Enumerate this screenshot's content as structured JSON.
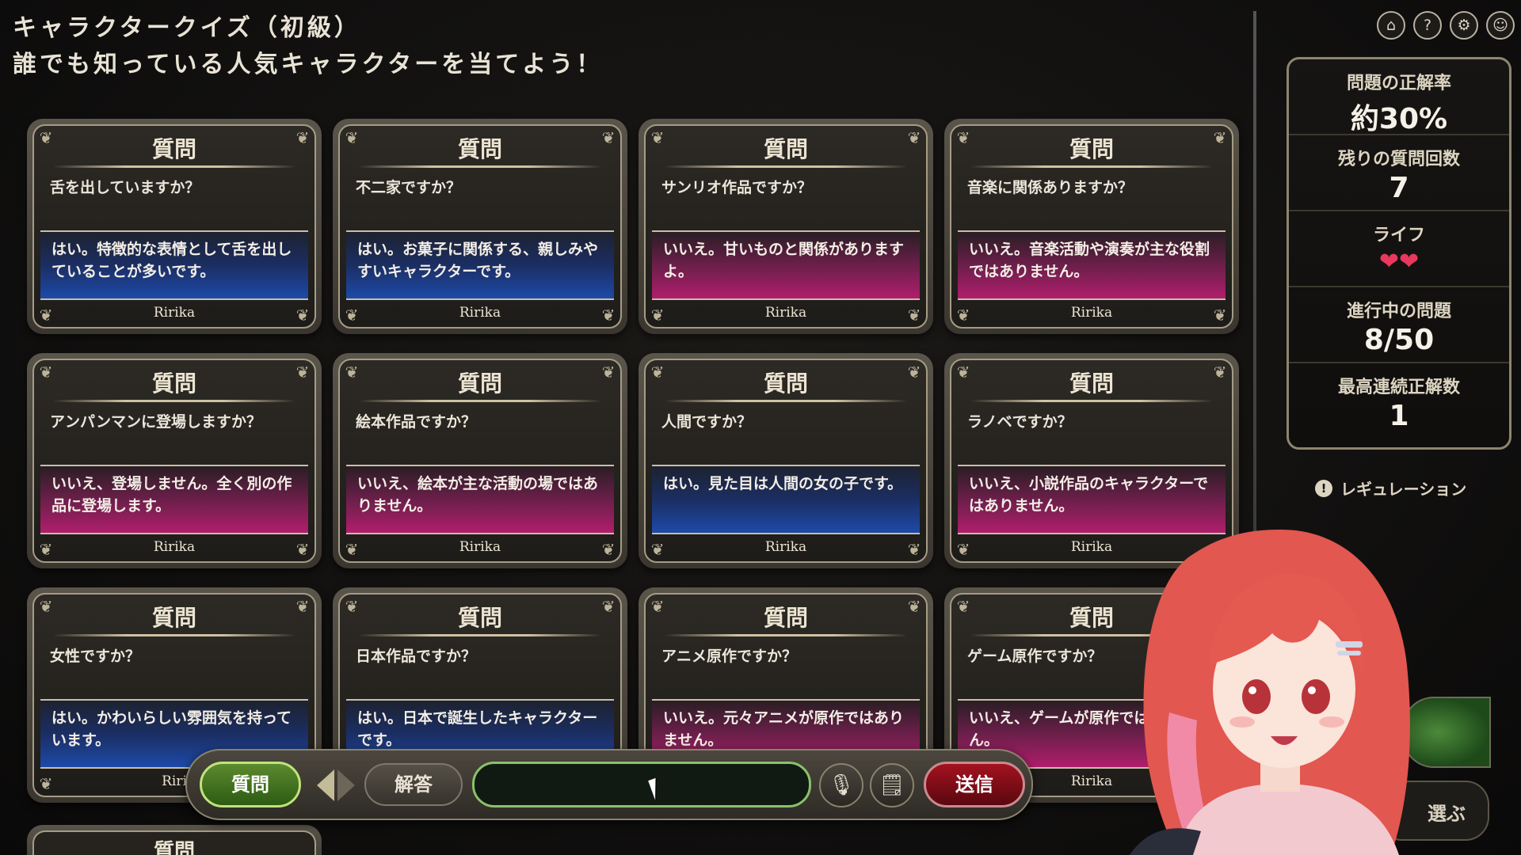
{
  "header": {
    "title": "キャラクタークイズ（初級）",
    "subtitle": "誰でも知っている人気キャラクターを当てよう！"
  },
  "cards": [
    {
      "head": "質問",
      "question": "舌を出していますか？",
      "answer": "はい。特徴的な表情として舌を出していることが多いです。",
      "result": "yes",
      "sig": "Ririka"
    },
    {
      "head": "質問",
      "question": "不二家ですか？",
      "answer": "はい。お菓子に関係する、親しみやすいキャラクターです。",
      "result": "yes",
      "sig": "Ririka"
    },
    {
      "head": "質問",
      "question": "サンリオ作品ですか？",
      "answer": "いいえ。甘いものと関係がありますよ。",
      "result": "no",
      "sig": "Ririka"
    },
    {
      "head": "質問",
      "question": "音楽に関係ありますか？",
      "answer": "いいえ。音楽活動や演奏が主な役割ではありません。",
      "result": "no",
      "sig": "Ririka"
    },
    {
      "head": "質問",
      "question": "アンパンマンに登場しますか？",
      "answer": "いいえ、登場しません。全く別の作品に登場します。",
      "result": "no",
      "sig": "Ririka"
    },
    {
      "head": "質問",
      "question": "絵本作品ですか？",
      "answer": "いいえ、絵本が主な活動の場ではありません。",
      "result": "no",
      "sig": "Ririka"
    },
    {
      "head": "質問",
      "question": "人間ですか？",
      "answer": "はい。見た目は人間の女の子です。",
      "result": "yes",
      "sig": "Ririka"
    },
    {
      "head": "質問",
      "question": "ラノベですか？",
      "answer": "いいえ、小説作品のキャラクターではありません。",
      "result": "no",
      "sig": "Ririka"
    },
    {
      "head": "質問",
      "question": "女性ですか？",
      "answer": "はい。かわいらしい雰囲気を持っています。",
      "result": "yes",
      "sig": "Riri"
    },
    {
      "head": "質問",
      "question": "日本作品ですか？",
      "answer": "はい。日本で誕生したキャラクターです。",
      "result": "yes",
      "sig": ""
    },
    {
      "head": "質問",
      "question": "アニメ原作ですか？",
      "answer": "いいえ。元々アニメが原作ではありません。",
      "result": "no",
      "sig": ""
    },
    {
      "head": "質問",
      "question": "ゲーム原作ですか？",
      "answer": "いいえ、ゲームが原作ではありません。",
      "result": "no",
      "sig": "Ririka"
    }
  ],
  "partial_card": {
    "head": "質問"
  },
  "stats": {
    "accuracy_label": "問題の正解率",
    "accuracy_value": "約30%",
    "remaining_label": "残りの質問回数",
    "remaining_value": "7",
    "life_label": "ライフ",
    "life_hearts": "❤❤",
    "progress_label": "進行中の問題",
    "progress_value": "8/50",
    "streak_label": "最高連続正解数",
    "streak_value": "1"
  },
  "regulation": {
    "icon": "!",
    "label": "レギュレーション"
  },
  "top_icons": [
    {
      "name": "home-icon",
      "glyph": "⌂"
    },
    {
      "name": "help-icon",
      "glyph": "?"
    },
    {
      "name": "settings-icon",
      "glyph": "⚙"
    },
    {
      "name": "discord-icon",
      "glyph": "☺"
    }
  ],
  "side": {
    "choose_label": "選ぶ"
  },
  "inputbar": {
    "question_label": "質問",
    "answer_label": "解答",
    "input_value": "",
    "mic_glyph": "🎙",
    "note_glyph": "🗒",
    "send_label": "送信"
  },
  "colors": {
    "yes": "#1d4aa8",
    "no": "#b01e6c",
    "send": "#a3121f",
    "question_active": "#5c8a2f"
  }
}
